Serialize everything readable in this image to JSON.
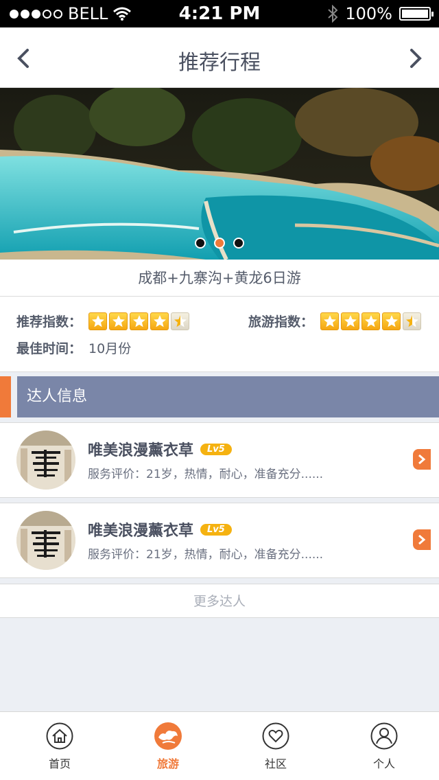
{
  "status_bar": {
    "carrier": "BELL",
    "time": "4:21 PM",
    "battery": "100%"
  },
  "nav": {
    "title": "推荐行程"
  },
  "hero": {
    "pages": 3,
    "active_page": 2
  },
  "trip": {
    "title": "成都+九寨沟+黄龙6日游",
    "recommend_label": "推荐指数：",
    "recommend_stars": 4.5,
    "travel_label": "旅游指数：",
    "travel_stars": 4.5,
    "best_time_label": "最佳时间：",
    "best_time_value": "10月份"
  },
  "experts_section": {
    "title": "达人信息"
  },
  "experts": [
    {
      "name": "唯美浪漫薰衣草",
      "level": "Lv5",
      "desc": "服务评价：21岁，热情，耐心，准备充分......"
    },
    {
      "name": "唯美浪漫薰衣草",
      "level": "Lv5",
      "desc": "服务评价：21岁，热情，耐心，准备充分......"
    }
  ],
  "more_label": "更多达人",
  "tabs": [
    {
      "label": "首页",
      "icon": "home-icon"
    },
    {
      "label": "旅游",
      "icon": "travel-icon",
      "active": true
    },
    {
      "label": "社区",
      "icon": "heart-icon"
    },
    {
      "label": "个人",
      "icon": "person-icon"
    }
  ],
  "colors": {
    "accent": "#f07a3a",
    "section": "#7a86a8",
    "star": "#f5b211"
  }
}
